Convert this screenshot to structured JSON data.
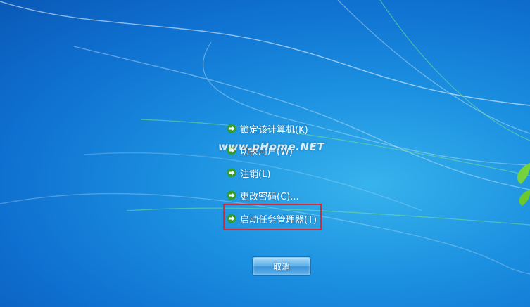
{
  "security_screen": {
    "menu": [
      {
        "label": "锁定该计算机(K)",
        "icon": "green-arrow-icon"
      },
      {
        "label": "切换用户(W)",
        "icon": "green-arrow-icon"
      },
      {
        "label": "注销(L)",
        "icon": "green-arrow-icon"
      },
      {
        "label": "更改密码(C)...",
        "icon": "green-arrow-icon"
      },
      {
        "label": "启动任务管理器(T)",
        "icon": "green-arrow-icon"
      }
    ],
    "cancel_label": "取消",
    "watermark": "www.pHome.NET"
  },
  "colors": {
    "highlight_border": "#e3262c",
    "arrow_green": "#3ec23c",
    "background_blue": "#1b8fe0"
  }
}
